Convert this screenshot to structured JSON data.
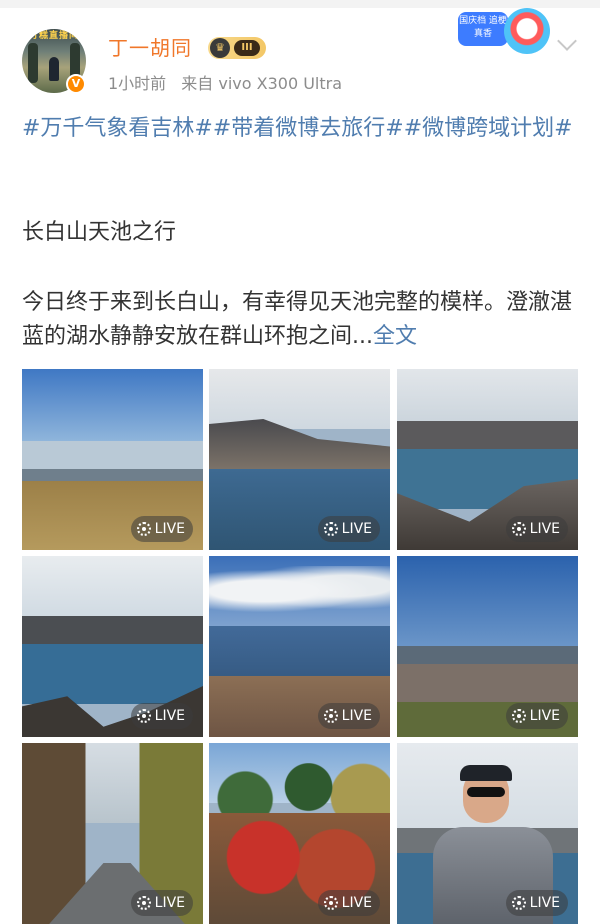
{
  "post": {
    "username": "丁一胡同",
    "vip_level": "III",
    "avatar_text": "打糕直播间",
    "verified_mark": "V",
    "time": "1小时前",
    "source": "来自 vivo X300 Ultra",
    "sticker_text": "国庆档 追梗真香",
    "hashtags": "#万千气象看吉林##带着微博去旅行##微博跨域计划#",
    "title": "长白山天池之行",
    "paragraph": "今日终于来到长白山，有幸得见天池完整的模样。澄澈湛蓝的湖水静静安放在群山环抱之间...",
    "full_text_link": "全文"
  },
  "photos": {
    "live_label": "LIVE",
    "count": 9
  },
  "colors": {
    "username": "#f0772a",
    "link": "#507daf",
    "meta": "#8c8c8c"
  }
}
